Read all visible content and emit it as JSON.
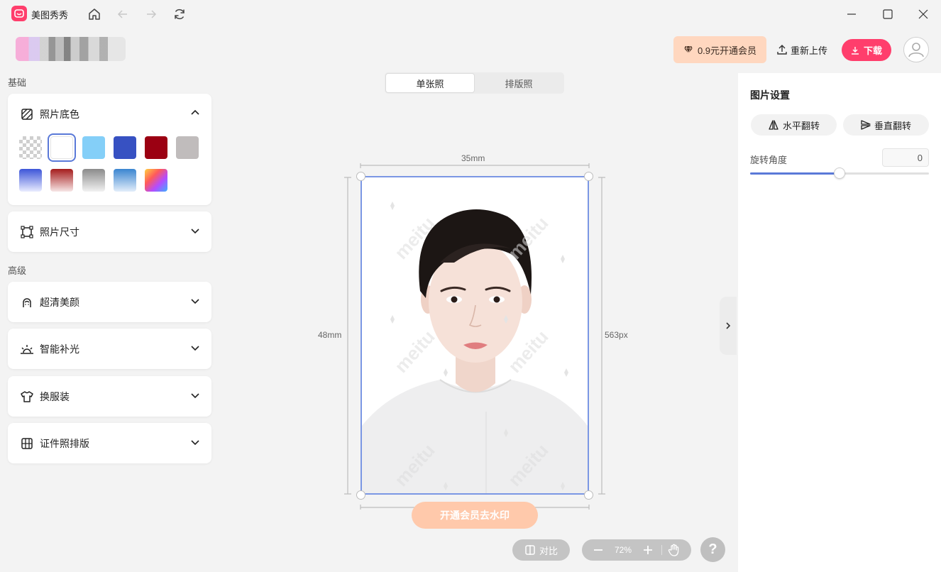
{
  "app": {
    "name": "美图秀秀"
  },
  "header": {
    "vip_label": "0.9元开通会员",
    "reupload_label": "重新上传",
    "download_label": "下载"
  },
  "left": {
    "basic_label": "基础",
    "advanced_label": "高级",
    "background": {
      "title": "照片底色",
      "swatches": [
        {
          "name": "transparent"
        },
        {
          "name": "white",
          "color": "#ffffff"
        },
        {
          "name": "light-blue",
          "color": "#84cff8"
        },
        {
          "name": "blue",
          "color": "#3751c2"
        },
        {
          "name": "dark-red",
          "color": "#9b0012"
        },
        {
          "name": "gray",
          "color": "#c0bcbc"
        },
        {
          "name": "blue-gradient"
        },
        {
          "name": "red-gradient"
        },
        {
          "name": "gray-gradient"
        },
        {
          "name": "sky-gradient"
        },
        {
          "name": "rainbow-gradient"
        }
      ]
    },
    "size": {
      "title": "照片尺寸"
    },
    "beauty": {
      "title": "超清美颜"
    },
    "light": {
      "title": "智能补光"
    },
    "outfit": {
      "title": "换服装"
    },
    "layout": {
      "title": "证件照排版"
    }
  },
  "tabs": {
    "single": "单张照",
    "layout": "排版照"
  },
  "canvas": {
    "width_label": "35mm",
    "height_label": "48mm",
    "px_label": "563px",
    "watermark": "meitu",
    "unlock_label": "开通会员去水印"
  },
  "toolbar": {
    "compare_label": "对比",
    "zoom_label": "72%",
    "help_label": "?"
  },
  "right": {
    "title": "图片设置",
    "flip_h_label": "水平翻转",
    "flip_v_label": "垂直翻转",
    "rotate_label": "旋转角度",
    "rotate_value": "0",
    "rotate_slider_fraction": 0.5
  },
  "colors": {
    "accent": "#ff3e6c",
    "selection": "#7b97e4",
    "vip_bg": "#ffd7bf"
  }
}
